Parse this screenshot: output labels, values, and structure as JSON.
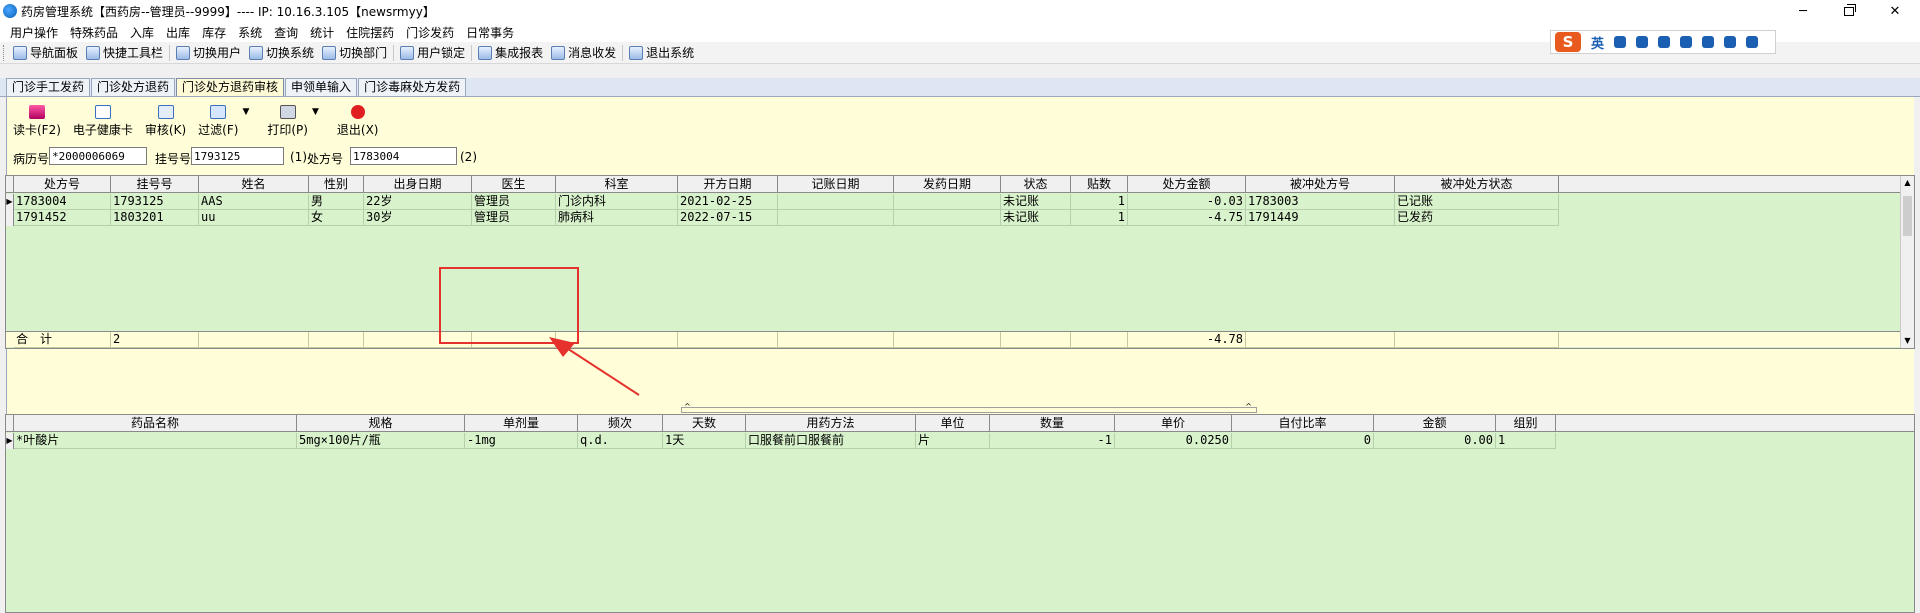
{
  "window": {
    "title": "药房管理系统【西药房--管理员--9999】---- IP: 10.16.3.105【newsrmyy】",
    "minimize": "─",
    "close": "✕"
  },
  "menu": [
    "用户操作",
    "特殊药品",
    "入库",
    "出库",
    "库存",
    "系统",
    "查询",
    "统计",
    "住院摆药",
    "门诊发药",
    "日常事务"
  ],
  "quickbar": [
    "导航面板",
    "快捷工具栏",
    "切换用户",
    "切换系统",
    "切换部门",
    "用户锁定",
    "集成报表",
    "消息收发",
    "退出系统"
  ],
  "ime": {
    "logo": "S",
    "lang": "英"
  },
  "tabs": [
    "门诊手工发药",
    "门诊处方退药",
    "门诊处方退药审核",
    "申领单输入",
    "门诊毒麻处方发药"
  ],
  "active_tab": "门诊处方退药审核",
  "actions": {
    "read_card": "读卡(F2)",
    "health_card": "电子健康卡",
    "audit": "审核(K)",
    "filter": "过滤(F)",
    "print": "打印(P)",
    "exit": "退出(X)",
    "dropdown_arrow": "▼"
  },
  "search": {
    "record_label": "病历号",
    "record_value": "*2000006069",
    "reg_label": "挂号号",
    "reg_value": "1793125",
    "reg_hint": "(1)",
    "rx_label": "处方号",
    "rx_value": "1783004",
    "rx_hint": "(2)"
  },
  "top_grid": {
    "columns": [
      "处方号",
      "挂号号",
      "姓名",
      "性别",
      "出身日期",
      "医生",
      "科室",
      "开方日期",
      "记账日期",
      "发药日期",
      "状态",
      "贴数",
      "处方金额",
      "被冲处方号",
      "被冲处方状态"
    ],
    "rows": [
      [
        "1783004",
        "1793125",
        "AAS",
        "男",
        "22岁",
        "管理员",
        "门诊内科",
        "2021-02-25",
        "",
        "",
        "未记账",
        "1",
        "-0.03",
        "1783003",
        "已记账"
      ],
      [
        "1791452",
        "1803201",
        "uu",
        "女",
        "30岁",
        "管理员",
        "肺病科",
        "2022-07-15",
        "",
        "",
        "未记账",
        "1",
        "-4.75",
        "1791449",
        "已发药"
      ]
    ],
    "summary": {
      "label": "合　计",
      "count": "2",
      "amount": "-4.78"
    }
  },
  "bottom_grid": {
    "columns": [
      "药品名称",
      "规格",
      "单剂量",
      "频次",
      "天数",
      "用药方法",
      "单位",
      "数量",
      "单价",
      "自付比率",
      "金额",
      "组别"
    ],
    "rows": [
      [
        "*叶酸片",
        "5mg×100片/瓶",
        "-1mg",
        "q.d.",
        "1天",
        "口服餐前口服餐前",
        "片",
        "-1",
        "0.0250",
        "0",
        "0.00",
        "1"
      ]
    ]
  },
  "annotation": {
    "color": "#e5322d"
  }
}
